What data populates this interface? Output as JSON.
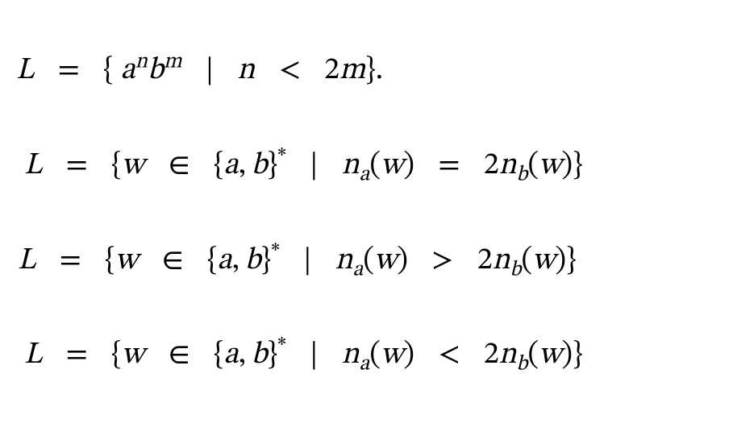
{
  "equations": {
    "eq1": {
      "lhs_var": "L",
      "eq": "=",
      "lbrace": "{",
      "a": "a",
      "n_sup": "n",
      "b": "b",
      "m_sup": "m",
      "bar": "|",
      "n": "n",
      "lt": "<",
      "two": "2",
      "m": "m",
      "rbrace": "}",
      "period": "."
    },
    "eq2": {
      "lhs_var": "L",
      "eq": "=",
      "lbrace": "{",
      "w": "w",
      "in": "∈",
      "al_l": "{",
      "a": "a",
      "comma": ",",
      "b": "b",
      "al_r": "}",
      "star": "*",
      "bar": "|",
      "n": "n",
      "sub_a": "a",
      "lp": "(",
      "arg": "w",
      "rp": ")",
      "rel": "=",
      "two": "2",
      "n2": "n",
      "sub_b": "b",
      "lp2": "(",
      "arg2": "w",
      "rp2": ")",
      "rbrace": "}"
    },
    "eq3": {
      "lhs_var": "L",
      "eq": "=",
      "lbrace": "{",
      "w": "w",
      "in": "∈",
      "al_l": "{",
      "a": "a",
      "comma": ",",
      "b": "b",
      "al_r": "}",
      "star": "*",
      "bar": "|",
      "n": "n",
      "sub_a": "a",
      "lp": "(",
      "arg": "w",
      "rp": ")",
      "rel": ">",
      "two": "2",
      "n2": "n",
      "sub_b": "b",
      "lp2": "(",
      "arg2": "w",
      "rp2": ")",
      "rbrace": "}"
    },
    "eq4": {
      "lhs_var": "L",
      "eq": "=",
      "lbrace": "{",
      "w": "w",
      "in": "∈",
      "al_l": "{",
      "a": "a",
      "comma": ",",
      "b": "b",
      "al_r": "}",
      "star": "*",
      "bar": "|",
      "n": "n",
      "sub_a": "a",
      "lp": "(",
      "arg": "w",
      "rp": ")",
      "rel": "<",
      "two": "2",
      "n2": "n",
      "sub_b": "b",
      "lp2": "(",
      "arg2": "w",
      "rp2": ")",
      "rbrace": "}"
    }
  }
}
